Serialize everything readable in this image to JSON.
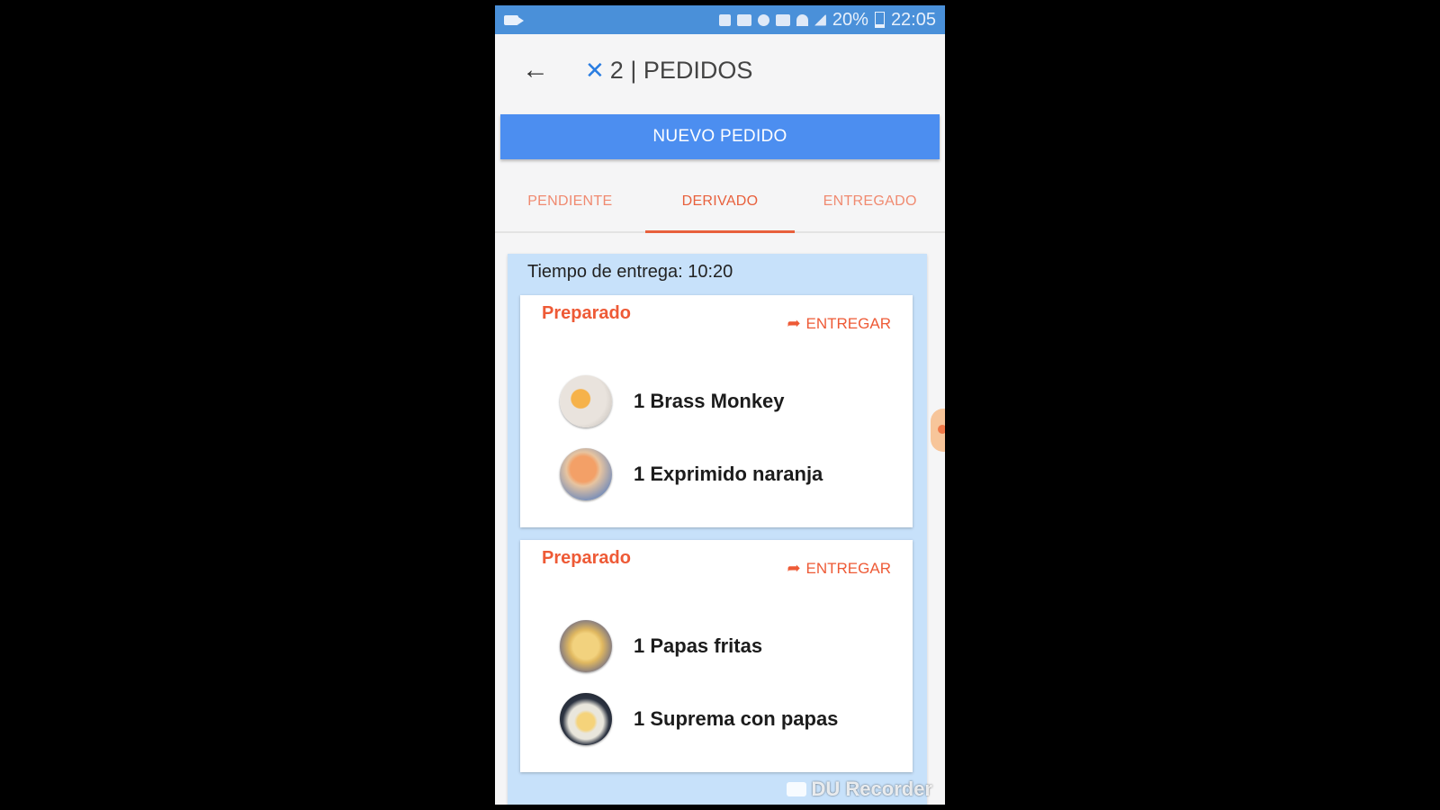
{
  "status_bar": {
    "battery": "20%",
    "time": "22:05",
    "icons": [
      "video-camera-icon",
      "nfc-icon",
      "mute-icon",
      "alarm-icon",
      "hd-icon",
      "wifi-icon",
      "signal-icon",
      "battery-icon"
    ]
  },
  "header": {
    "back_icon": "arrow-left-icon",
    "title_icon": "cutlery-icon",
    "title": "2 | PEDIDOS"
  },
  "new_order_button": "NUEVO PEDIDO",
  "tabs": [
    {
      "label": "PENDIENTE",
      "active": false
    },
    {
      "label": "DERIVADO",
      "active": true
    },
    {
      "label": "ENTREGADO",
      "active": false
    }
  ],
  "delivery_time": "Tiempo de entrega: 10:20",
  "orders": [
    {
      "status": "Preparado",
      "action": "ENTREGAR",
      "items": [
        {
          "label": "1 Brass Monkey",
          "image": "drink-glass"
        },
        {
          "label": "1 Exprimido naranja",
          "image": "orange-juice"
        }
      ]
    },
    {
      "status": "Preparado",
      "action": "ENTREGAR",
      "items": [
        {
          "label": "1 Papas fritas",
          "image": "french-fries"
        },
        {
          "label": "1 Suprema con papas",
          "image": "chicken-plate"
        }
      ]
    }
  ],
  "watermark": "DU Recorder",
  "colors": {
    "status_bar": "#4a90d9",
    "primary_button": "#4c8ef0",
    "accent": "#ee5a36",
    "panel": "#c7e1fa"
  }
}
